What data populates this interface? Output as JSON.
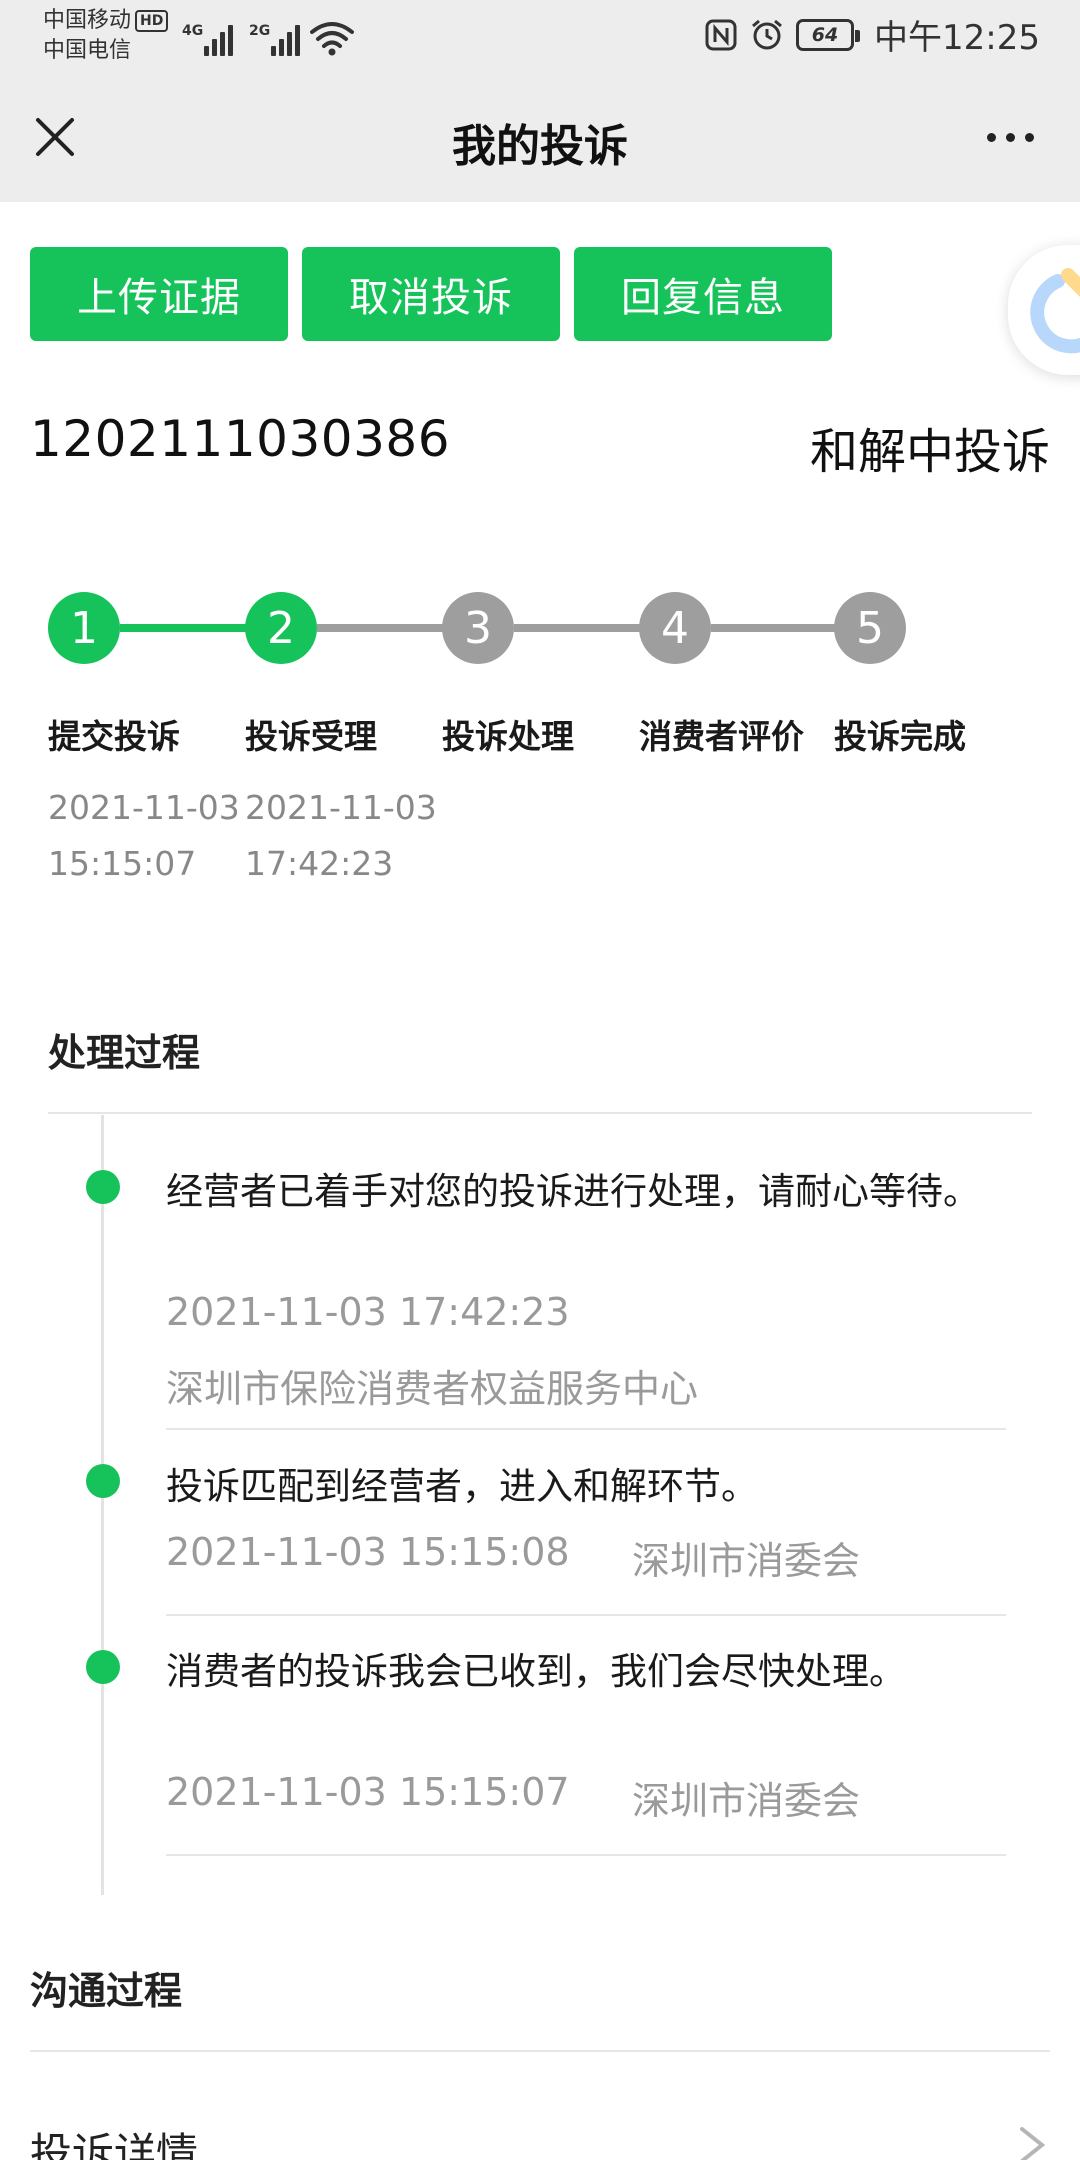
{
  "status_bar": {
    "carrier1": "中国移动",
    "hd": "HD",
    "carrier2": "中国电信",
    "net1": "4G",
    "net2": "2G",
    "battery": "64",
    "time": "中午12:25"
  },
  "header": {
    "title": "我的投诉"
  },
  "actions": [
    {
      "label": "上传证据"
    },
    {
      "label": "取消投诉"
    },
    {
      "label": "回复信息"
    }
  ],
  "case": {
    "number": "1202111030386",
    "status": "和解中投诉"
  },
  "progress": {
    "steps": [
      {
        "num": "1",
        "label": "提交投诉",
        "time": "2021-11-03 15:15:07",
        "done": true
      },
      {
        "num": "2",
        "label": "投诉受理",
        "time": "2021-11-03 17:42:23",
        "done": true
      },
      {
        "num": "3",
        "label": "投诉处理",
        "time": "",
        "done": false
      },
      {
        "num": "4",
        "label": "消费者评价",
        "time": "",
        "done": false
      },
      {
        "num": "5",
        "label": "投诉完成",
        "time": "",
        "done": false
      }
    ],
    "active_color": "#15c35a",
    "inactive_color": "#9e9e9e"
  },
  "process": {
    "title": "处理过程",
    "entries": [
      {
        "text": "经营者已着手对您的投诉进行处理，请耐心等待。",
        "time": "2021-11-03 17:42:23",
        "org": "深圳市保险消费者权益服务中心"
      },
      {
        "text": "投诉匹配到经营者，进入和解环节。",
        "time": "2021-11-03 15:15:08",
        "org": "深圳市消委会"
      },
      {
        "text": "消费者的投诉我会已收到，我们会尽快处理。",
        "time": "2021-11-03 15:15:07",
        "org": "深圳市消委会"
      }
    ]
  },
  "communication": {
    "title": "沟通过程"
  },
  "details": {
    "title": "投诉详情"
  },
  "icons": {
    "close": "close-icon",
    "more": "more-icon",
    "nfc": "nfc-icon",
    "alarm": "alarm-icon",
    "wifi": "wifi-icon",
    "chevron": "chevron-right-icon"
  },
  "colors": {
    "accent": "#15c35a",
    "header_bg": "#ededed"
  }
}
